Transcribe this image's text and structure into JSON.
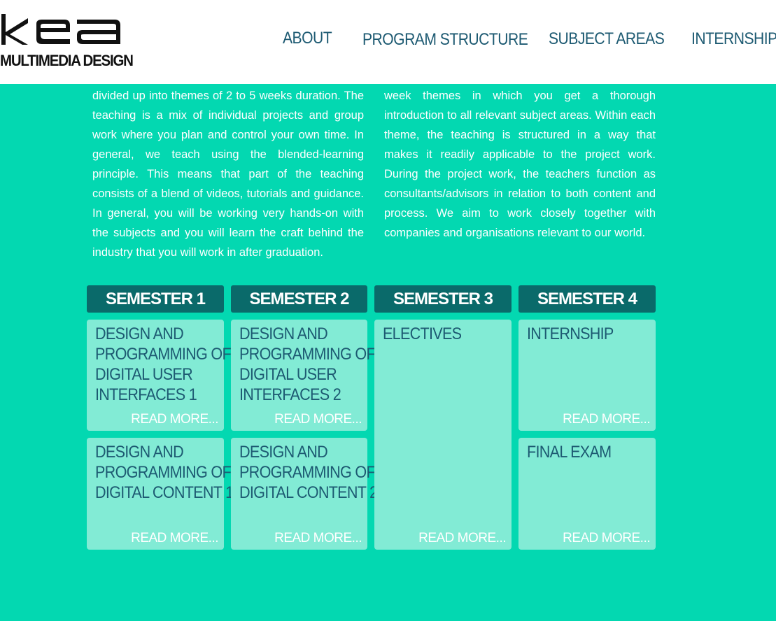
{
  "header": {
    "logo_text": "MULTIMEDIA DESIGN",
    "nav": {
      "about": "ABOUT",
      "program_structure": "PROGRAM STRUCTURE",
      "subject_areas": "SUBJECT AREAS",
      "internship": "INTERNSHIP"
    }
  },
  "intro": {
    "left": "divided up into themes of 2 to 5 weeks duration. The teaching is a mix of individual projects and group work where you plan and control your own time. In general, we teach using the blended-learning principle. This means that part of the teaching consists of a blend of videos, tutorials and guidance. In general, you will be working very hands-on with the subjects and you will learn the craft behind the industry that you will work in after graduation.",
    "right": "week themes in which you get a thorough introduction to all relevant subject areas. Within each theme, the teaching is structured in a way that makes it readily applicable to the project work. During the project work, the teachers function as consultants/advisors in relation to both content and process. We aim to work closely together with companies and organisations relevant to our world."
  },
  "semesters": [
    {
      "label": "SEMESTER 1",
      "cards": [
        {
          "title": "DESIGN AND PROGRAMMING OF DIGITAL USER INTERFACES 1",
          "link": "READ MORE..."
        },
        {
          "title": "DESIGN AND PROGRAMMING OF DIGITAL CONTENT 1",
          "link": "READ MORE..."
        }
      ]
    },
    {
      "label": "SEMESTER 2",
      "cards": [
        {
          "title": "DESIGN AND PROGRAMMING OF DIGITAL USER INTERFACES 2",
          "link": "READ MORE..."
        },
        {
          "title": "DESIGN AND PROGRAMMING OF DIGITAL CONTENT 2",
          "link": "READ MORE..."
        }
      ]
    },
    {
      "label": "SEMESTER 3",
      "cards": [
        {
          "title": "ELECTIVES",
          "link": "READ MORE..."
        }
      ]
    },
    {
      "label": "SEMESTER 4",
      "cards": [
        {
          "title": "INTERNSHIP",
          "link": "READ MORE..."
        },
        {
          "title": "FINAL EXAM",
          "link": "READ MORE..."
        }
      ]
    }
  ],
  "colors": {
    "background": "#03d8b1",
    "semester_header": "#0a6a6a",
    "card": "#82ebd5",
    "title_text": "#1d5a72"
  }
}
